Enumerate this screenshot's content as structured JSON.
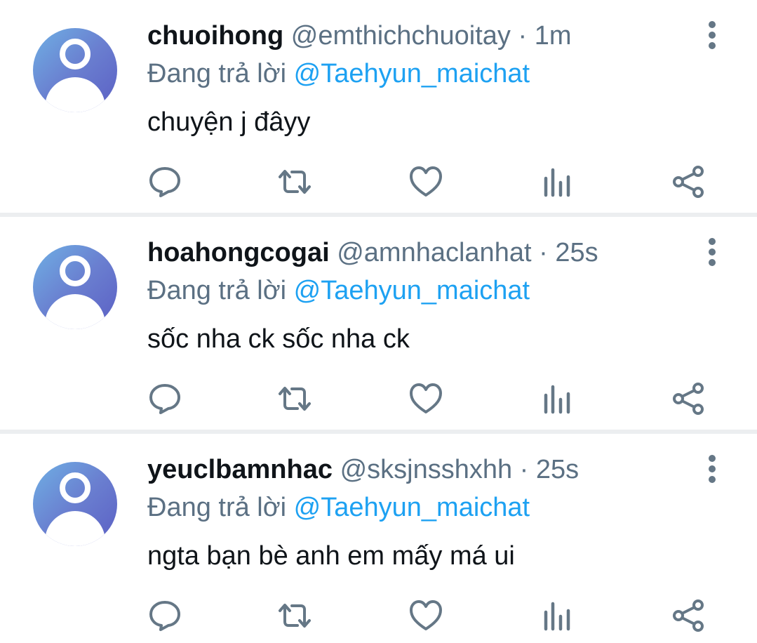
{
  "tweets": [
    {
      "display_name": "chuoihong",
      "handle": "@emthichchuoitay",
      "separator": " · ",
      "time": "1m",
      "reply_prefix": "Đang trả lời",
      "reply_to": "@Taehyun_maichat",
      "text": "chuyện j đâyy"
    },
    {
      "display_name": "hoahongcogai",
      "handle": "@amnhaclanhat",
      "separator": " · ",
      "time": "25s",
      "reply_prefix": "Đang trả lời",
      "reply_to": "@Taehyun_maichat",
      "text": "sốc nha ck sốc nha ck"
    },
    {
      "display_name": "yeuclbamnhac",
      "handle": "@sksjnsshxhh",
      "separator": " · ",
      "time": "25s",
      "reply_prefix": "Đang trả lời",
      "reply_to": "@Taehyun_maichat",
      "text": "ngta bạn bè anh em mấy má ui"
    }
  ],
  "icons": {
    "avatar": "default-avatar-icon",
    "more": "more-vertical-icon",
    "reply": "reply-icon",
    "retweet": "retweet-icon",
    "like": "heart-icon",
    "stats": "analytics-icon",
    "share": "share-icon"
  },
  "colors": {
    "text_primary": "#0f1419",
    "text_secondary": "#5b7083",
    "link": "#1da1f2",
    "icon": "#657786",
    "divider": "#eceef0",
    "avatar_gradient_start": "#6fb0e4",
    "avatar_gradient_end": "#5b5fc4"
  }
}
